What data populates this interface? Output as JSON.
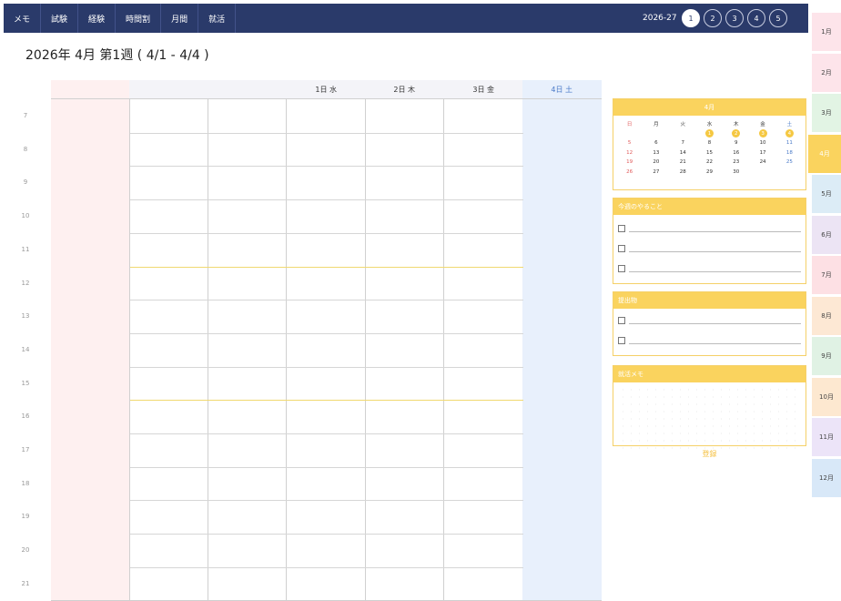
{
  "nav": {
    "items": [
      "メモ",
      "試験",
      "経験",
      "時間割",
      "月間",
      "就活"
    ]
  },
  "header": {
    "year_label": "2026-27",
    "weeks": [
      "1",
      "2",
      "3",
      "4",
      "5"
    ],
    "active_week": "1"
  },
  "page_title": "2026年 4月 第1週 ( 4/1 - 4/4 )",
  "days": [
    {
      "label": "",
      "bg": "#fef0f0",
      "color": "#333333"
    },
    {
      "label": "",
      "bg": "#f4f4f8",
      "color": "#333333"
    },
    {
      "label": "",
      "bg": "#f4f4f8",
      "color": "#333333"
    },
    {
      "label": "1日 水",
      "bg": "#f4f4f8",
      "color": "#333333"
    },
    {
      "label": "2日 木",
      "bg": "#f4f4f8",
      "color": "#333333"
    },
    {
      "label": "3日 金",
      "bg": "#f4f4f8",
      "color": "#333333"
    },
    {
      "label": "4日 土",
      "bg": "#e8f0fc",
      "color": "#4a7ac8"
    }
  ],
  "hours": [
    "7",
    "8",
    "9",
    "10",
    "11",
    "12",
    "13",
    "14",
    "15",
    "16",
    "17",
    "18",
    "19",
    "20",
    "21"
  ],
  "mini_calendar": {
    "title": "4月",
    "weekdays": [
      "日",
      "月",
      "火",
      "水",
      "木",
      "金",
      "土"
    ],
    "weeks": [
      [
        "",
        "",
        "",
        "1",
        "2",
        "3",
        "4"
      ],
      [
        "5",
        "6",
        "7",
        "8",
        "9",
        "10",
        "11"
      ],
      [
        "12",
        "13",
        "14",
        "15",
        "16",
        "17",
        "18"
      ],
      [
        "19",
        "20",
        "21",
        "22",
        "23",
        "24",
        "25"
      ],
      [
        "26",
        "27",
        "28",
        "29",
        "30",
        "",
        ""
      ]
    ],
    "highlighted": [
      "1",
      "2",
      "3",
      "4"
    ]
  },
  "todo": {
    "title": "今週のやること",
    "count": 3
  },
  "submissions": {
    "title": "提出物",
    "count": 2
  },
  "job_memo": {
    "title": "就活メモ"
  },
  "register_label": "登録",
  "months": [
    {
      "label": "1月",
      "color": "#fde4ea"
    },
    {
      "label": "2月",
      "color": "#fde4ea"
    },
    {
      "label": "3月",
      "color": "#e2f4e4"
    },
    {
      "label": "4月",
      "color": "#fad35e"
    },
    {
      "label": "5月",
      "color": "#dcecf6"
    },
    {
      "label": "6月",
      "color": "#ece4f4"
    },
    {
      "label": "7月",
      "color": "#fde0e4"
    },
    {
      "label": "8月",
      "color": "#fde8d4"
    },
    {
      "label": "9月",
      "color": "#e0f2e4"
    },
    {
      "label": "10月",
      "color": "#fde8d0"
    },
    {
      "label": "11月",
      "color": "#ece4f8"
    },
    {
      "label": "12月",
      "color": "#d8e8f8"
    }
  ],
  "active_month": "4月"
}
